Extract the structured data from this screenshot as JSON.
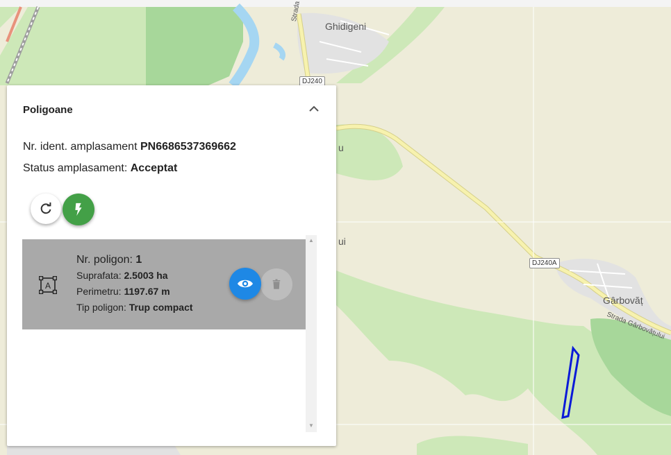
{
  "map": {
    "places": {
      "ghidigeni": "Ghidigeni",
      "garbovat": "Gârbovăț",
      "street_chi": "Strada Ch",
      "street_garbovat": "Strada Gârbovățului",
      "partial_u": "u",
      "partial_ui": "ui"
    },
    "roads": {
      "dj240": "DJ240",
      "dj240a": "DJ240A"
    },
    "colors": {
      "background": "#eeecd9",
      "forest": "#cde8b8",
      "dense_forest": "#a7d79a",
      "river": "#a5d6f2",
      "road": "#f7f2ae",
      "polygon_outline": "#0a1ad8"
    }
  },
  "panel": {
    "title": "Poligoane",
    "collapse_icon": "chevron-up-icon",
    "site_id_label": "Nr. ident. amplasament",
    "site_id_value": "PN6686537369662",
    "status_label": "Status amplasament:",
    "status_value": "Acceptat",
    "actions": {
      "refresh_icon": "refresh-icon",
      "generate_icon": "lightning-icon",
      "generate_color": "#43a047"
    }
  },
  "polygons": [
    {
      "number_label": "Nr. poligon:",
      "number_value": "1",
      "area_label": "Suprafata:",
      "area_value": "2.5003 ha",
      "perimeter_label": "Perimetru:",
      "perimeter_value": "1197.67 m",
      "type_label": "Tip poligon:",
      "type_value": "Trup compact",
      "icon": "polygon-shape-icon",
      "view_icon": "eye-icon",
      "view_color": "#1e88e5",
      "delete_icon": "trash-icon"
    }
  ]
}
